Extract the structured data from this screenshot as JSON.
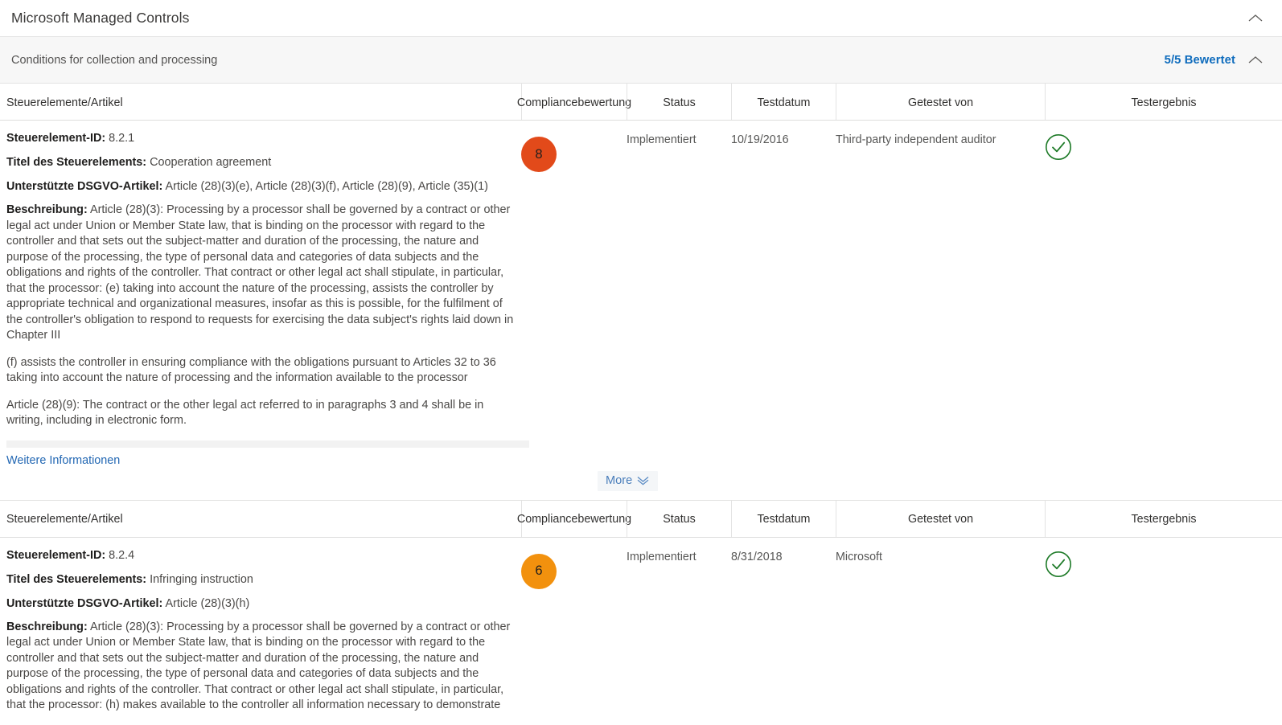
{
  "window": {
    "title": "Microsoft Managed Controls",
    "collapse_icon": "chevron-up-icon"
  },
  "section": {
    "title": "Conditions for collection and processing",
    "rated_label": "5/5 Bewertet",
    "collapse_icon": "chevron-up-icon"
  },
  "table": {
    "columns": [
      "Steuerelemente/Artikel",
      "Compliancebewertung",
      "Status",
      "Testdatum",
      "Getestet von",
      "Testergebnis"
    ],
    "labels": {
      "control_id": "Steuerelement-ID:",
      "control_title": "Titel des Steuerelements:",
      "gdpr_articles": "Unterstützte DSGVO-Artikel:",
      "description": "Beschreibung:"
    },
    "more_link_label": "Weitere Informationen",
    "more_button_label": "More",
    "more_button_icon": "chevron-double-down-icon",
    "result_icon": "check-circle-icon"
  },
  "rows": [
    {
      "control_id": "8.2.1",
      "control_title": "Cooperation agreement",
      "gdpr_articles": "Article (28)(3)(e), Article (28)(3)(f), Article (28)(9), Article (35)(1)",
      "description_paragraphs": [
        "Article (28)(3): Processing by a processor shall be governed by a contract or other legal act under Union or Member State law, that is binding on the processor with regard to the controller and that sets out the subject-matter and duration of the processing, the nature and purpose of the processing, the type of personal data and categories of data subjects and the obligations and rights of the controller. That contract or other legal act shall stipulate, in particular, that the processor: (e) taking into account the nature of the processing, assists the controller by appropriate technical and organizational measures, insofar as this is possible, for the fulfilment of the controller's obligation to respond to requests for exercising the data subject's rights laid down in Chapter III",
        "(f) assists the controller in ensuring compliance with the obligations pursuant to Articles 32 to 36 taking into account the nature of processing and the information available to the processor",
        "Article (28)(9): The contract or the other legal act referred to in paragraphs 3 and 4 shall be in writing, including in electronic form."
      ],
      "compliance_score": "8",
      "compliance_score_color": "#e24a1a",
      "status": "Implementiert",
      "test_date": "10/19/2016",
      "tested_by": "Third-party independent auditor",
      "test_result_color": "#1d7a27"
    },
    {
      "control_id": "8.2.4",
      "control_title": "Infringing instruction",
      "gdpr_articles": "Article (28)(3)(h)",
      "description_paragraphs": [
        "Article (28)(3): Processing by a processor shall be governed by a contract or other legal act under Union or Member State law, that is binding on the processor with regard to the controller and that sets out the subject-matter and duration of the processing, the nature and purpose of the processing, the type of personal data and categories of data subjects and the obligations and rights of the controller. That contract or other legal act shall stipulate, in particular, that the processor: (h) makes available to the controller all information necessary to demonstrate"
      ],
      "compliance_score": "6",
      "compliance_score_color": "#f2910e",
      "status": "Implementiert",
      "test_date": "8/31/2018",
      "tested_by": "Microsoft",
      "test_result_color": "#1d7a27"
    }
  ]
}
